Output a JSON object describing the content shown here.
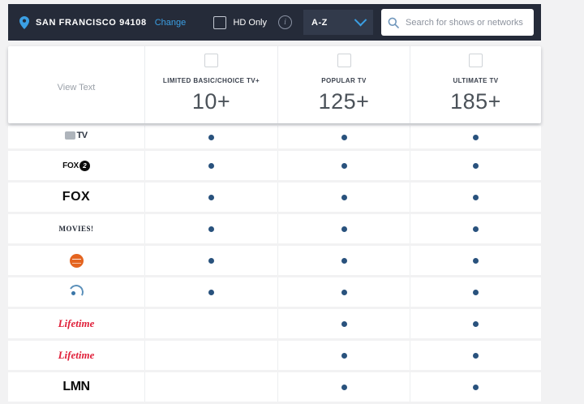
{
  "header": {
    "location_text": "SAN FRANCISCO 94108",
    "change_label": "Change",
    "hd_only_label": "HD Only",
    "sort_value": "A-Z",
    "search_placeholder": "Search for shows or networks"
  },
  "table": {
    "view_text_label": "View Text",
    "packages": [
      {
        "name": "LIMITED BASIC/CHOICE TV+",
        "count": "10+"
      },
      {
        "name": "POPULAR TV",
        "count": "125+"
      },
      {
        "name": "ULTIMATE TV",
        "count": "185+"
      }
    ],
    "rows": [
      {
        "channel": "TV",
        "logo": "tvset",
        "logo_text": "TV",
        "logo_badge": "",
        "included": [
          true,
          true,
          true
        ]
      },
      {
        "channel": "FOX 2",
        "logo": "fox2",
        "logo_text": "FOX",
        "logo_badge": "2",
        "included": [
          true,
          true,
          true
        ]
      },
      {
        "channel": "FOX",
        "logo": "fox",
        "logo_text": "FOX",
        "logo_badge": "",
        "included": [
          true,
          true,
          true
        ]
      },
      {
        "channel": "MOVIES!",
        "logo": "movies",
        "logo_text": "MOVIES!",
        "logo_badge": "",
        "included": [
          true,
          true,
          true
        ]
      },
      {
        "channel": "",
        "logo": "orange-ball",
        "logo_text": "",
        "logo_badge": "",
        "included": [
          true,
          true,
          true
        ]
      },
      {
        "channel": "",
        "logo": "signal-waves",
        "logo_text": "",
        "logo_badge": "",
        "included": [
          true,
          true,
          true
        ]
      },
      {
        "channel": "Lifetime",
        "logo": "lifetime",
        "logo_text": "Lifetime",
        "logo_badge": "",
        "included": [
          false,
          true,
          true
        ]
      },
      {
        "channel": "Lifetime",
        "logo": "lifetime",
        "logo_text": "Lifetime",
        "logo_badge": "",
        "included": [
          false,
          true,
          true
        ]
      },
      {
        "channel": "LMN",
        "logo": "lmn",
        "logo_text": "LMN",
        "logo_badge": "",
        "included": [
          false,
          true,
          true
        ]
      }
    ]
  },
  "colors": {
    "topbar_bg": "#252b39",
    "accent_blue": "#3b9fe3",
    "dot_navy": "#29527d",
    "page_bg": "#f2f2f3",
    "lifetime_red": "#e0203a",
    "orange_logo": "#e4641f"
  }
}
